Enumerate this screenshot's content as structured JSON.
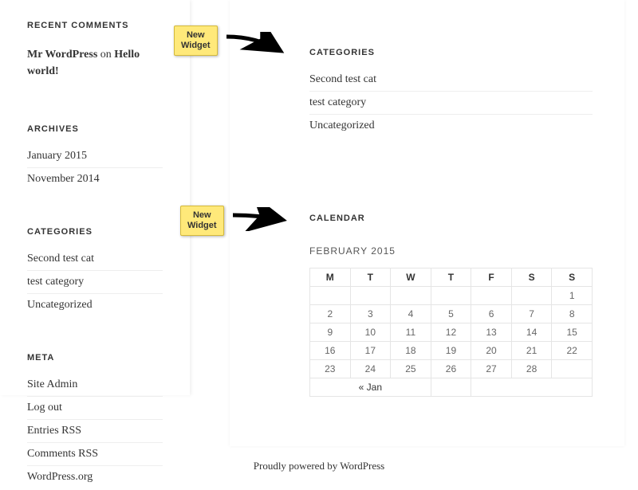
{
  "sidebar": {
    "recent_comments": {
      "title": "RECENT COMMENTS",
      "author": "Mr WordPress",
      "on": " on ",
      "post": "Hello world!"
    },
    "archives": {
      "title": "ARCHIVES",
      "items": [
        "January 2015",
        "November 2014"
      ]
    },
    "categories": {
      "title": "CATEGORIES",
      "items": [
        "Second test cat",
        "test category",
        "Uncategorized"
      ]
    },
    "meta": {
      "title": "META",
      "items": [
        "Site Admin",
        "Log out",
        "Entries RSS",
        "Comments RSS",
        "WordPress.org"
      ]
    }
  },
  "main": {
    "categories": {
      "title": "CATEGORIES",
      "items": [
        "Second test cat",
        "test category",
        "Uncategorized"
      ]
    },
    "calendar": {
      "title": "CALENDAR",
      "caption": "FEBRUARY 2015",
      "days": [
        "M",
        "T",
        "W",
        "T",
        "F",
        "S",
        "S"
      ],
      "weeks": [
        [
          "",
          "",
          "",
          "",
          "",
          "",
          "1"
        ],
        [
          "2",
          "3",
          "4",
          "5",
          "6",
          "7",
          "8"
        ],
        [
          "9",
          "10",
          "11",
          "12",
          "13",
          "14",
          "15"
        ],
        [
          "16",
          "17",
          "18",
          "19",
          "20",
          "21",
          "22"
        ],
        [
          "23",
          "24",
          "25",
          "26",
          "27",
          "28",
          ""
        ]
      ],
      "prev": "« Jan"
    }
  },
  "annotations": {
    "note1": "New\nWidget",
    "note2": "New\nWidget"
  },
  "footer": {
    "text": "Proudly powered by WordPress"
  }
}
